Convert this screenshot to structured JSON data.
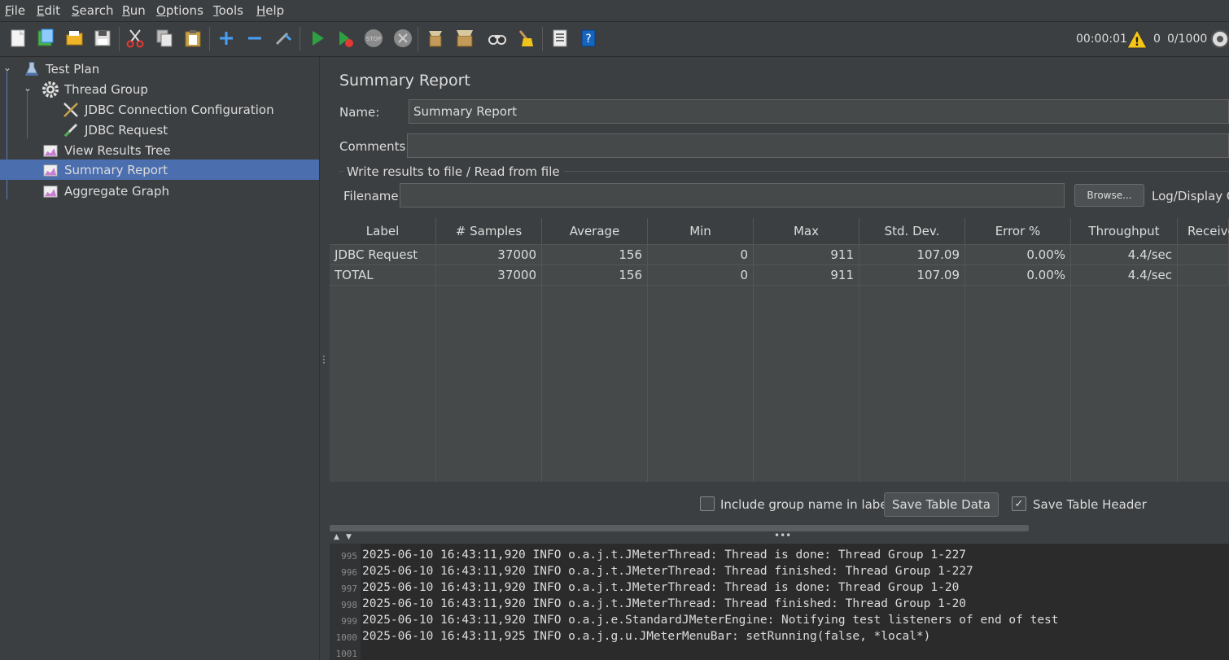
{
  "menu": [
    {
      "first": "F",
      "rest": "ile"
    },
    {
      "first": "E",
      "rest": "dit"
    },
    {
      "first": "S",
      "rest": "earch"
    },
    {
      "first": "R",
      "rest": "un"
    },
    {
      "first": "O",
      "rest": "ptions"
    },
    {
      "first": "T",
      "rest": "ools"
    },
    {
      "first": "H",
      "rest": "elp"
    }
  ],
  "toolbar": {
    "elapsed": "00:00:01",
    "warnings": "0",
    "threads": "0/1000"
  },
  "tree": {
    "test_plan": "Test Plan",
    "thread_group": "Thread Group",
    "jdbc_config": "JDBC Connection Configuration",
    "jdbc_request": "JDBC Request",
    "view_results_tree": "View Results Tree",
    "summary_report": "Summary Report",
    "aggregate_graph": "Aggregate Graph"
  },
  "panel": {
    "title": "Summary Report",
    "name_label": "Name:",
    "name_value": "Summary Report",
    "comments_label": "Comments:",
    "comments_value": "",
    "file_section": "Write results to file / Read from file",
    "filename_label": "Filename",
    "filename_value": "",
    "browse": "Browse...",
    "log_display": "Log/Display O"
  },
  "table": {
    "headers": [
      "Label",
      "# Samples",
      "Average",
      "Min",
      "Max",
      "Std. Dev.",
      "Error %",
      "Throughput",
      "Receive"
    ],
    "rows": [
      [
        "JDBC Request",
        "37000",
        "156",
        "0",
        "911",
        "107.09",
        "0.00%",
        "4.4/sec",
        ""
      ],
      [
        "TOTAL",
        "37000",
        "156",
        "0",
        "911",
        "107.09",
        "0.00%",
        "4.4/sec",
        ""
      ]
    ]
  },
  "footer": {
    "include_group": "Include group name in label?",
    "include_group_checked": false,
    "save_table_data": "Save Table Data",
    "save_table_header": "Save Table Header",
    "save_table_header_checked": true
  },
  "log": {
    "lines": [
      {
        "n": "995",
        "text": "2025-06-10 16:43:11,920 INFO o.a.j.t.JMeterThread: Thread is done: Thread Group 1-227"
      },
      {
        "n": "996",
        "text": "2025-06-10 16:43:11,920 INFO o.a.j.t.JMeterThread: Thread finished: Thread Group 1-227"
      },
      {
        "n": "997",
        "text": "2025-06-10 16:43:11,920 INFO o.a.j.t.JMeterThread: Thread is done: Thread Group 1-20"
      },
      {
        "n": "998",
        "text": "2025-06-10 16:43:11,920 INFO o.a.j.t.JMeterThread: Thread finished: Thread Group 1-20"
      },
      {
        "n": "999",
        "text": "2025-06-10 16:43:11,920 INFO o.a.j.e.StandardJMeterEngine: Notifying test listeners of end of test"
      },
      {
        "n": "1000",
        "text": "2025-06-10 16:43:11,925 INFO o.a.j.g.u.JMeterMenuBar: setRunning(false, *local*)"
      },
      {
        "n": "1001",
        "text": ""
      }
    ]
  }
}
